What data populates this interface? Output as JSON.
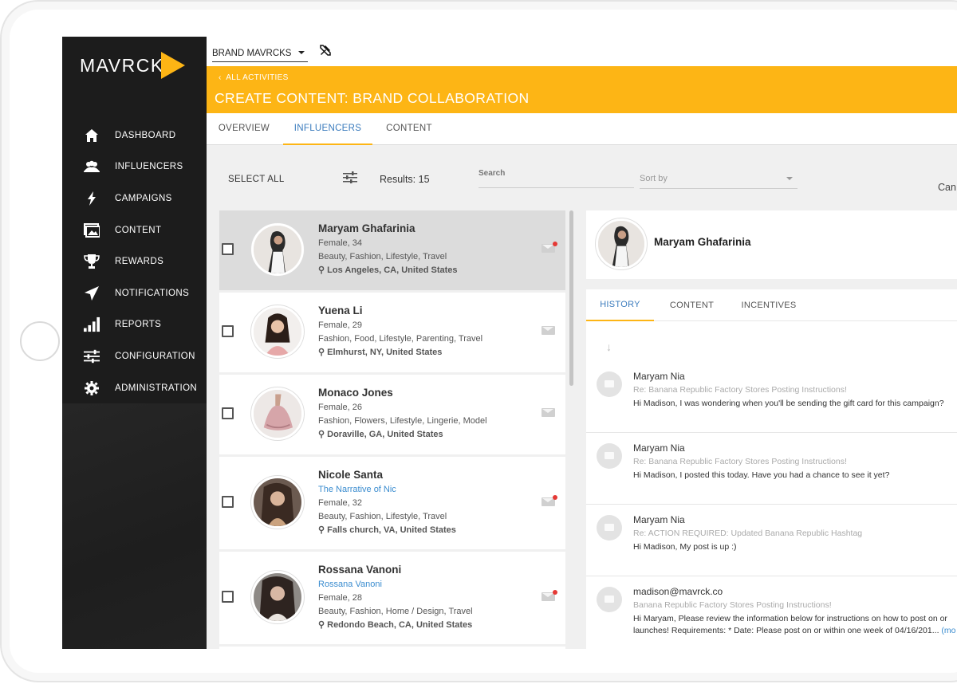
{
  "app": {
    "logo_text": "MAVRCK",
    "brand_select": "BRAND MAVRCKS",
    "colors": {
      "accent": "#fdb515",
      "link": "#3a8ccf",
      "active_tab": "#3a7bbd",
      "sidebar": "#1c1c1c",
      "alert_dot": "#e53935"
    }
  },
  "sidebar": {
    "items": [
      {
        "label": "DASHBOARD",
        "icon": "home-icon"
      },
      {
        "label": "INFLUENCERS",
        "icon": "people-icon"
      },
      {
        "label": "CAMPAIGNS",
        "icon": "lightning-icon"
      },
      {
        "label": "CONTENT",
        "icon": "images-icon"
      },
      {
        "label": "REWARDS",
        "icon": "trophy-icon"
      },
      {
        "label": "NOTIFICATIONS",
        "icon": "paper-plane-icon"
      },
      {
        "label": "REPORTS",
        "icon": "signal-bars-icon"
      },
      {
        "label": "CONFIGURATION",
        "icon": "sliders-icon"
      },
      {
        "label": "ADMINISTRATION",
        "icon": "gear-icon"
      }
    ]
  },
  "header": {
    "back_label": "ALL ACTIVITIES",
    "title": "CREATE CONTENT: BRAND COLLABORATION"
  },
  "tabs": [
    {
      "label": "OVERVIEW",
      "active": false
    },
    {
      "label": "INFLUENCERS",
      "active": true
    },
    {
      "label": "CONTENT",
      "active": false
    }
  ],
  "toolbar": {
    "select_all": "SELECT ALL",
    "results": "Results: 15",
    "search_placeholder": "Search",
    "sort_placeholder": "Sort by",
    "cancel_partial": "Can"
  },
  "influencers": [
    {
      "name": "Maryam Ghafarinia",
      "link": "",
      "gender_age": "Female, 34",
      "categories": "Beauty, Fashion, Lifestyle, Travel",
      "location": "Los Angeles, CA, United States",
      "unread": true,
      "selected": true
    },
    {
      "name": "Yuena Li",
      "link": "",
      "gender_age": "Female, 29",
      "categories": "Fashion, Food, Lifestyle, Parenting, Travel",
      "location": "Elmhurst, NY, United States",
      "unread": false,
      "selected": false
    },
    {
      "name": "Monaco Jones",
      "link": "",
      "gender_age": "Female, 26",
      "categories": "Fashion, Flowers, Lifestyle, Lingerie, Model",
      "location": "Doraville, GA, United States",
      "unread": false,
      "selected": false
    },
    {
      "name": "Nicole Santa",
      "link": "The Narrative of Nic",
      "gender_age": "Female, 32",
      "categories": "Beauty, Fashion, Lifestyle, Travel",
      "location": "Falls church, VA, United States",
      "unread": true,
      "selected": false
    },
    {
      "name": "Rossana Vanoni",
      "link": "Rossana Vanoni",
      "gender_age": "Female, 28",
      "categories": "Beauty, Fashion, Home / Design, Travel",
      "location": "Redondo Beach, CA, United States",
      "unread": true,
      "selected": false
    }
  ],
  "detail": {
    "profile_name": "Maryam Ghafarinia",
    "tabs": [
      {
        "label": "HISTORY",
        "active": true
      },
      {
        "label": "CONTENT",
        "active": false
      },
      {
        "label": "INCENTIVES",
        "active": false
      }
    ],
    "sort_arrow": "↓",
    "messages": [
      {
        "from": "Maryam Nia",
        "subject": "Re: Banana Republic Factory Stores Posting Instructions!",
        "body": "Hi Madison, I was wondering when you'll be sending the gift card for this campaign?",
        "body2": "",
        "more": ""
      },
      {
        "from": "Maryam Nia",
        "subject": "Re: Banana Republic Factory Stores Posting Instructions!",
        "body": "Hi Madison, I posted this today. Have you had a chance to see it yet?",
        "body2": "",
        "more": ""
      },
      {
        "from": "Maryam Nia",
        "subject": "Re: ACTION REQUIRED: Updated Banana Republic Hashtag",
        "body": "Hi Madison, My post is up :)",
        "body2": "",
        "more": ""
      },
      {
        "from": "madison@mavrck.co",
        "subject": "Banana Republic Factory Stores Posting Instructions!",
        "body": "Hi Maryam, Please review the information below for instructions on how to post on or",
        "body2": "launches! Requirements: * Date: Please post on or within one week of 04/16/201...",
        "more": "(mo"
      }
    ]
  }
}
